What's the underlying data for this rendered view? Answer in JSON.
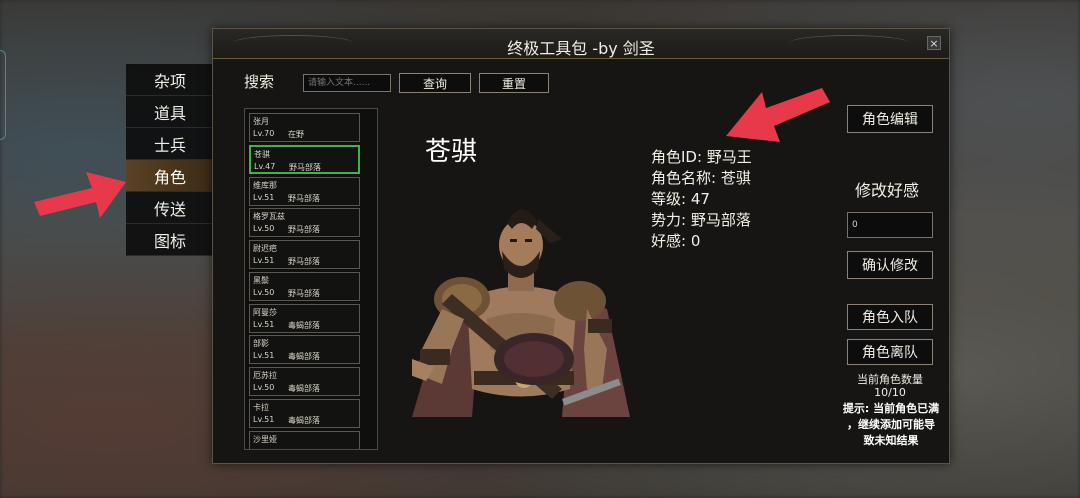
{
  "window": {
    "title": "终极工具包 -by 剑圣",
    "close_icon": "×"
  },
  "categories": [
    {
      "label": "杂项",
      "active": false
    },
    {
      "label": "道具",
      "active": false
    },
    {
      "label": "士兵",
      "active": false
    },
    {
      "label": "角色",
      "active": true
    },
    {
      "label": "传送",
      "active": false
    },
    {
      "label": "图标",
      "active": false
    }
  ],
  "search": {
    "label": "搜索",
    "placeholder": "请输入文本......",
    "query_button": "查询",
    "reset_button": "重置"
  },
  "characters": [
    {
      "name": "张月",
      "level": "Lv.70",
      "faction": "在野"
    },
    {
      "name": "苍骐",
      "level": "Lv.47",
      "faction": "野马部落",
      "selected": true
    },
    {
      "name": "维库那",
      "level": "Lv.51",
      "faction": "野马部落"
    },
    {
      "name": "格罗瓦兹",
      "level": "Lv.50",
      "faction": "野马部落"
    },
    {
      "name": "尉迟疤",
      "level": "Lv.51",
      "faction": "野马部落"
    },
    {
      "name": "黑鬃",
      "level": "Lv.50",
      "faction": "野马部落"
    },
    {
      "name": "阿曼莎",
      "level": "Lv.51",
      "faction": "毒蝎部落"
    },
    {
      "name": "部影",
      "level": "Lv.51",
      "faction": "毒蝎部落"
    },
    {
      "name": "厄苏拉",
      "level": "Lv.50",
      "faction": "毒蝎部落"
    },
    {
      "name": "卡拉",
      "level": "Lv.51",
      "faction": "毒蝎部落"
    },
    {
      "name": "沙里娅",
      "level": "",
      "faction": ""
    }
  ],
  "selected": {
    "display_name": "苍骐",
    "id_line": "角色ID: 野马王",
    "name_line": "角色名称: 苍骐",
    "level_line": "等级: 47",
    "faction_line": "势力: 野马部落",
    "favor_line": "好感: 0"
  },
  "actions": {
    "edit_button": "角色编辑",
    "modify_title": "修改好感",
    "favor_value": "0",
    "confirm_button": "确认修改",
    "join_button": "角色入队",
    "leave_button": "角色离队",
    "count_label": "当前角色数量",
    "count_value": "10/10",
    "hint_line1": "提示: 当前角色已满",
    "hint_line2": "，继续添加可能导",
    "hint_line3": "致未知结果"
  },
  "colors": {
    "selected_border": "#3fb24b",
    "arrow": "#e8394a",
    "active_tab": "#5a4224"
  }
}
